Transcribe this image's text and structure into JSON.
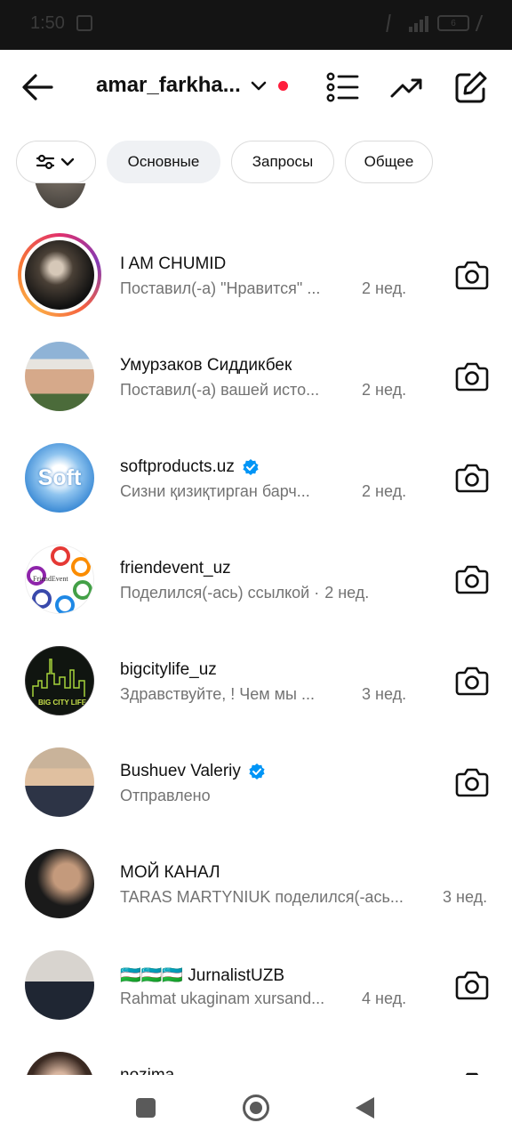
{
  "status_bar": {
    "time": "1:50",
    "battery": "6"
  },
  "header": {
    "account_name": "amar_farkha...",
    "icons": [
      "back-arrow-icon",
      "chevron-down-icon",
      "list-icon",
      "trending-icon",
      "compose-icon"
    ]
  },
  "filters": {
    "chips": [
      {
        "label": ""
      },
      {
        "label": "Основные"
      },
      {
        "label": "Запросы"
      },
      {
        "label": "Общее"
      }
    ]
  },
  "conversations": [
    {
      "name": "I AM CHUMID",
      "message": "Поставил(-а) \"Нравится\" ...",
      "time": "2 нед.",
      "verified": false,
      "story_ring": true
    },
    {
      "name": "Умурзаков Сиддикбек",
      "message": "Поставил(-а) вашей исто...",
      "time": "2 нед.",
      "verified": false
    },
    {
      "name": "softproducts.uz",
      "message": "Сизни қизиқтирган барч...",
      "time": "2 нед.",
      "verified": true,
      "avatar_text": "Soft"
    },
    {
      "name": "friendevent_uz",
      "message": "Поделился(-ась) ссылкой ·",
      "time": "2 нед.",
      "verified": false,
      "avatar_text": "FriendEvent"
    },
    {
      "name": "bigcitylife_uz",
      "message": "Здравствуйте, ! Чем мы ...",
      "time": "3 нед.",
      "verified": false,
      "avatar_text": "BIG CITY LIFE"
    },
    {
      "name": "Bushuev Valeriy",
      "message": "Отправлено",
      "time": "",
      "verified": true
    },
    {
      "name": "МОЙ КАНАЛ",
      "message": "TARAS MARTYNIUK поделился(-ась...",
      "time": "3 нед.",
      "verified": false,
      "no_camera": true
    },
    {
      "name": "🇺🇿🇺🇿🇺🇿 JurnalistUZB",
      "message": "Rahmat ukaginam xursand...",
      "time": "4 нед.",
      "verified": false
    },
    {
      "name": "nozima",
      "message": "",
      "time": "",
      "verified": false
    }
  ],
  "colors": {
    "accent_red": "#ff1e3c",
    "verified_blue": "#0095f6",
    "secondary_text": "#737373"
  }
}
